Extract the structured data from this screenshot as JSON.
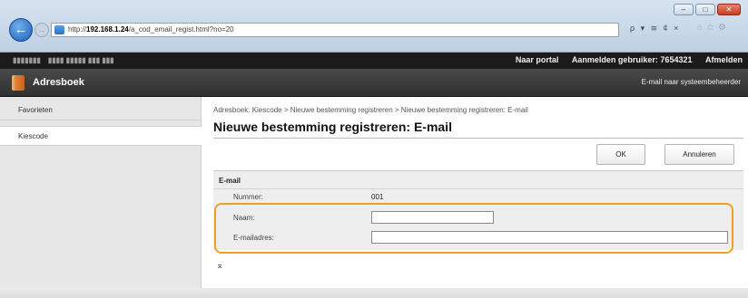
{
  "browser": {
    "address_prefix": "http://",
    "address_host": "192.168.1.24",
    "address_path": "/a_cod_email_regist.html?no=20",
    "search_tools": "ρ ▾ ≅ ¢ ×",
    "window_buttons": [
      "–",
      "□",
      "✕"
    ],
    "back_glyph": "←",
    "forward_glyph": "→"
  },
  "topbar": {
    "portal_link": "Naar portal",
    "login_user": "Aanmelden gebruiker: 7654321",
    "logout_link": "Afmelden"
  },
  "header": {
    "title": "Adresboek",
    "email_admin": "E-mail naar systeembeheerder"
  },
  "sidebar": {
    "items": [
      {
        "label": "Favorieten"
      },
      {
        "label": "Kiescode"
      }
    ]
  },
  "main": {
    "breadcrumb": "Adresboek: Kiescode > Nieuwe bestemming registreren > Nieuwe bestemming registreren: E-mail",
    "page_title": "Nieuwe bestemming registreren: E-mail",
    "ok_label": "OK",
    "cancel_label": "Annuleren",
    "section_title": "E-mail",
    "number_label": "Nummer:",
    "number_value": "001",
    "name_label": "Naam:",
    "name_value": "",
    "email_label": "E-mailadres:",
    "email_value": "",
    "top_link": "⌅"
  },
  "colors": {
    "highlight": "#f0a020",
    "titlebar": "#303030",
    "topbar": "#1b1b1b"
  }
}
